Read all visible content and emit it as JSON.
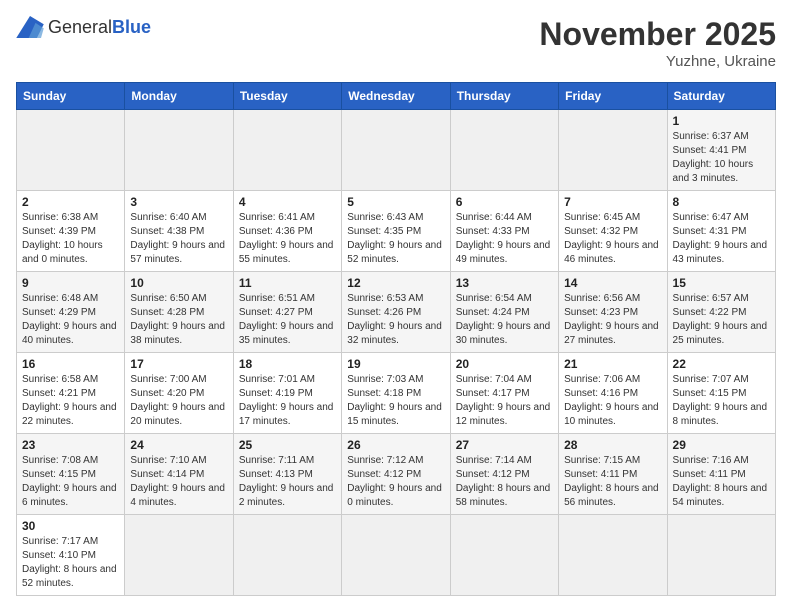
{
  "header": {
    "logo_general": "General",
    "logo_blue": "Blue",
    "month_title": "November 2025",
    "location": "Yuzhne, Ukraine"
  },
  "weekdays": [
    "Sunday",
    "Monday",
    "Tuesday",
    "Wednesday",
    "Thursday",
    "Friday",
    "Saturday"
  ],
  "weeks": [
    [
      {
        "day": "",
        "info": ""
      },
      {
        "day": "",
        "info": ""
      },
      {
        "day": "",
        "info": ""
      },
      {
        "day": "",
        "info": ""
      },
      {
        "day": "",
        "info": ""
      },
      {
        "day": "",
        "info": ""
      },
      {
        "day": "1",
        "info": "Sunrise: 6:37 AM\nSunset: 4:41 PM\nDaylight: 10 hours and 3 minutes."
      }
    ],
    [
      {
        "day": "2",
        "info": "Sunrise: 6:38 AM\nSunset: 4:39 PM\nDaylight: 10 hours and 0 minutes."
      },
      {
        "day": "3",
        "info": "Sunrise: 6:40 AM\nSunset: 4:38 PM\nDaylight: 9 hours and 57 minutes."
      },
      {
        "day": "4",
        "info": "Sunrise: 6:41 AM\nSunset: 4:36 PM\nDaylight: 9 hours and 55 minutes."
      },
      {
        "day": "5",
        "info": "Sunrise: 6:43 AM\nSunset: 4:35 PM\nDaylight: 9 hours and 52 minutes."
      },
      {
        "day": "6",
        "info": "Sunrise: 6:44 AM\nSunset: 4:33 PM\nDaylight: 9 hours and 49 minutes."
      },
      {
        "day": "7",
        "info": "Sunrise: 6:45 AM\nSunset: 4:32 PM\nDaylight: 9 hours and 46 minutes."
      },
      {
        "day": "8",
        "info": "Sunrise: 6:47 AM\nSunset: 4:31 PM\nDaylight: 9 hours and 43 minutes."
      }
    ],
    [
      {
        "day": "9",
        "info": "Sunrise: 6:48 AM\nSunset: 4:29 PM\nDaylight: 9 hours and 40 minutes."
      },
      {
        "day": "10",
        "info": "Sunrise: 6:50 AM\nSunset: 4:28 PM\nDaylight: 9 hours and 38 minutes."
      },
      {
        "day": "11",
        "info": "Sunrise: 6:51 AM\nSunset: 4:27 PM\nDaylight: 9 hours and 35 minutes."
      },
      {
        "day": "12",
        "info": "Sunrise: 6:53 AM\nSunset: 4:26 PM\nDaylight: 9 hours and 32 minutes."
      },
      {
        "day": "13",
        "info": "Sunrise: 6:54 AM\nSunset: 4:24 PM\nDaylight: 9 hours and 30 minutes."
      },
      {
        "day": "14",
        "info": "Sunrise: 6:56 AM\nSunset: 4:23 PM\nDaylight: 9 hours and 27 minutes."
      },
      {
        "day": "15",
        "info": "Sunrise: 6:57 AM\nSunset: 4:22 PM\nDaylight: 9 hours and 25 minutes."
      }
    ],
    [
      {
        "day": "16",
        "info": "Sunrise: 6:58 AM\nSunset: 4:21 PM\nDaylight: 9 hours and 22 minutes."
      },
      {
        "day": "17",
        "info": "Sunrise: 7:00 AM\nSunset: 4:20 PM\nDaylight: 9 hours and 20 minutes."
      },
      {
        "day": "18",
        "info": "Sunrise: 7:01 AM\nSunset: 4:19 PM\nDaylight: 9 hours and 17 minutes."
      },
      {
        "day": "19",
        "info": "Sunrise: 7:03 AM\nSunset: 4:18 PM\nDaylight: 9 hours and 15 minutes."
      },
      {
        "day": "20",
        "info": "Sunrise: 7:04 AM\nSunset: 4:17 PM\nDaylight: 9 hours and 12 minutes."
      },
      {
        "day": "21",
        "info": "Sunrise: 7:06 AM\nSunset: 4:16 PM\nDaylight: 9 hours and 10 minutes."
      },
      {
        "day": "22",
        "info": "Sunrise: 7:07 AM\nSunset: 4:15 PM\nDaylight: 9 hours and 8 minutes."
      }
    ],
    [
      {
        "day": "23",
        "info": "Sunrise: 7:08 AM\nSunset: 4:15 PM\nDaylight: 9 hours and 6 minutes."
      },
      {
        "day": "24",
        "info": "Sunrise: 7:10 AM\nSunset: 4:14 PM\nDaylight: 9 hours and 4 minutes."
      },
      {
        "day": "25",
        "info": "Sunrise: 7:11 AM\nSunset: 4:13 PM\nDaylight: 9 hours and 2 minutes."
      },
      {
        "day": "26",
        "info": "Sunrise: 7:12 AM\nSunset: 4:12 PM\nDaylight: 9 hours and 0 minutes."
      },
      {
        "day": "27",
        "info": "Sunrise: 7:14 AM\nSunset: 4:12 PM\nDaylight: 8 hours and 58 minutes."
      },
      {
        "day": "28",
        "info": "Sunrise: 7:15 AM\nSunset: 4:11 PM\nDaylight: 8 hours and 56 minutes."
      },
      {
        "day": "29",
        "info": "Sunrise: 7:16 AM\nSunset: 4:11 PM\nDaylight: 8 hours and 54 minutes."
      }
    ],
    [
      {
        "day": "30",
        "info": "Sunrise: 7:17 AM\nSunset: 4:10 PM\nDaylight: 8 hours and 52 minutes."
      },
      {
        "day": "",
        "info": ""
      },
      {
        "day": "",
        "info": ""
      },
      {
        "day": "",
        "info": ""
      },
      {
        "day": "",
        "info": ""
      },
      {
        "day": "",
        "info": ""
      },
      {
        "day": "",
        "info": ""
      }
    ]
  ]
}
